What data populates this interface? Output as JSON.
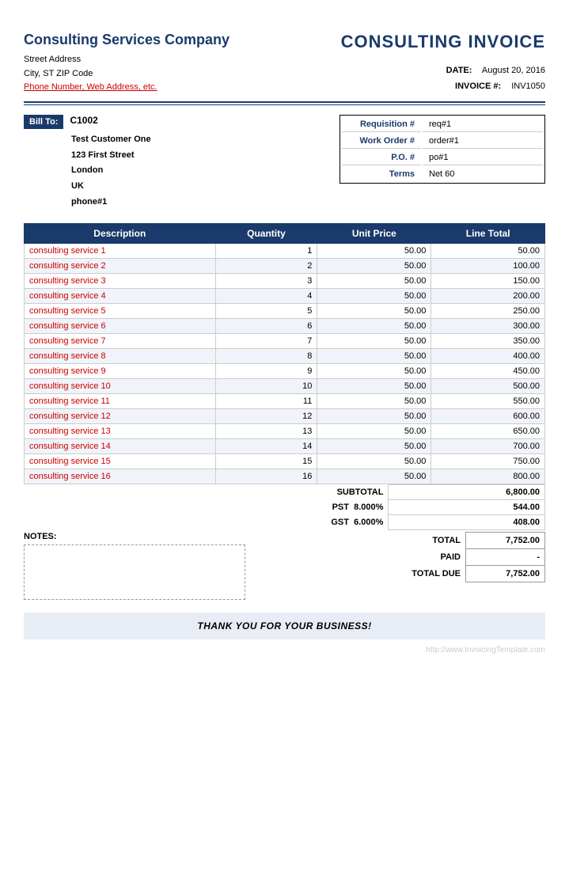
{
  "company": {
    "name": "Consulting Services Company",
    "address1": "Street Address",
    "address2": "City, ST  ZIP Code",
    "contact": "Phone Number, Web Address, etc."
  },
  "invoice": {
    "title": "CONSULTING INVOICE",
    "date_label": "DATE:",
    "date_value": "August 20, 2016",
    "invoice_label": "INVOICE #:",
    "invoice_value": "INV1050"
  },
  "bill_to": {
    "label": "Bill To:",
    "customer_id": "C1002",
    "name": "Test Customer One",
    "address1": "123 First Street",
    "city": "London",
    "country": "UK",
    "phone": "phone#1"
  },
  "requisition": {
    "req_label": "Requisition #",
    "req_value": "req#1",
    "wo_label": "Work Order #",
    "wo_value": "order#1",
    "po_label": "P.O. #",
    "po_value": "po#1",
    "terms_label": "Terms",
    "terms_value": "Net 60"
  },
  "table": {
    "headers": [
      "Description",
      "Quantity",
      "Unit Price",
      "Line Total"
    ],
    "rows": [
      {
        "desc": "consulting service 1",
        "qty": "1",
        "unit": "50.00",
        "total": "50.00"
      },
      {
        "desc": "consulting service 2",
        "qty": "2",
        "unit": "50.00",
        "total": "100.00"
      },
      {
        "desc": "consulting service 3",
        "qty": "3",
        "unit": "50.00",
        "total": "150.00"
      },
      {
        "desc": "consulting service 4",
        "qty": "4",
        "unit": "50.00",
        "total": "200.00"
      },
      {
        "desc": "consulting service  5",
        "qty": "5",
        "unit": "50.00",
        "total": "250.00"
      },
      {
        "desc": "consulting service 6",
        "qty": "6",
        "unit": "50.00",
        "total": "300.00"
      },
      {
        "desc": "consulting service 7",
        "qty": "7",
        "unit": "50.00",
        "total": "350.00"
      },
      {
        "desc": "consulting service 8",
        "qty": "8",
        "unit": "50.00",
        "total": "400.00"
      },
      {
        "desc": "consulting service 9",
        "qty": "9",
        "unit": "50.00",
        "total": "450.00"
      },
      {
        "desc": "consulting service 10",
        "qty": "10",
        "unit": "50.00",
        "total": "500.00"
      },
      {
        "desc": "consulting service 11",
        "qty": "11",
        "unit": "50.00",
        "total": "550.00"
      },
      {
        "desc": "consulting service 12",
        "qty": "12",
        "unit": "50.00",
        "total": "600.00"
      },
      {
        "desc": "consulting service 13",
        "qty": "13",
        "unit": "50.00",
        "total": "650.00"
      },
      {
        "desc": "consulting service 14",
        "qty": "14",
        "unit": "50.00",
        "total": "700.00"
      },
      {
        "desc": "consulting service 15",
        "qty": "15",
        "unit": "50.00",
        "total": "750.00"
      },
      {
        "desc": "consulting service 16",
        "qty": "16",
        "unit": "50.00",
        "total": "800.00"
      }
    ]
  },
  "totals": {
    "subtotal_label": "SUBTOTAL",
    "subtotal_value": "6,800.00",
    "pst_label": "PST",
    "pst_rate": "8.000%",
    "pst_value": "544.00",
    "gst_label": "GST",
    "gst_rate": "6.000%",
    "gst_value": "408.00",
    "total_label": "TOTAL",
    "total_value": "7,752.00",
    "paid_label": "PAID",
    "paid_value": "-",
    "due_label": "TOTAL DUE",
    "due_value": "7,752.00"
  },
  "notes": {
    "label": "NOTES:"
  },
  "footer": {
    "thank_you": "THANK YOU FOR YOUR BUSINESS!",
    "watermark": "http://www.InvoicingTemplate.com"
  }
}
